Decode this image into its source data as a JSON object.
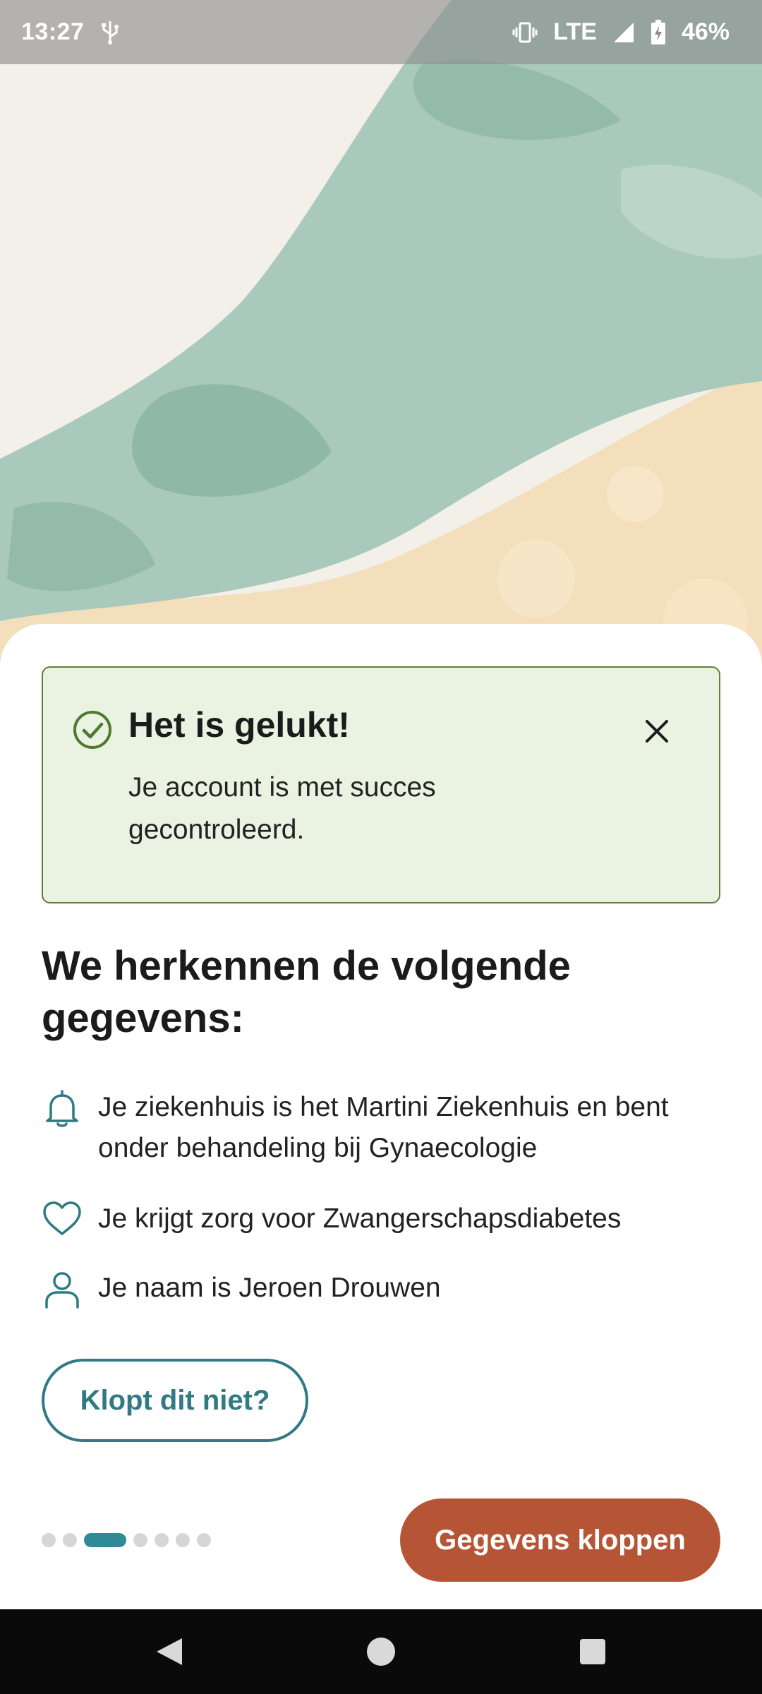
{
  "status_bar": {
    "time": "13:27",
    "network": "LTE",
    "battery": "46%",
    "icons": [
      "usb-icon",
      "vibrate-icon",
      "signal-icon",
      "battery-charging-icon"
    ]
  },
  "banner": {
    "title": "Het is gelukt!",
    "message": "Je account is met succes gecontroleerd.",
    "icon": "check-circle-icon",
    "close_icon": "close-icon",
    "colors": {
      "background": "#eaf3e2",
      "border": "#5f7f3a"
    }
  },
  "section": {
    "title": "We herkennen de volgende gegevens:"
  },
  "info_items": [
    {
      "icon": "bell-icon",
      "text": "Je ziekenhuis is het Martini Ziekenhuis en bent onder behandeling bij Gynaecologie"
    },
    {
      "icon": "heart-icon",
      "text": "Je krijgt zorg voor Zwangerschapsdiabetes"
    },
    {
      "icon": "person-icon",
      "text": "Je naam is Jeroen Drouwen"
    }
  ],
  "buttons": {
    "not_correct": "Klopt dit niet?",
    "confirm": "Gegevens kloppen"
  },
  "pager": {
    "total": 7,
    "current": 3
  },
  "nav": {
    "icons": [
      "back-icon",
      "home-icon",
      "recents-icon"
    ]
  },
  "colors": {
    "accent": "#2f7a83",
    "primary_button": "#b65535",
    "text": "#1b1b1b"
  }
}
